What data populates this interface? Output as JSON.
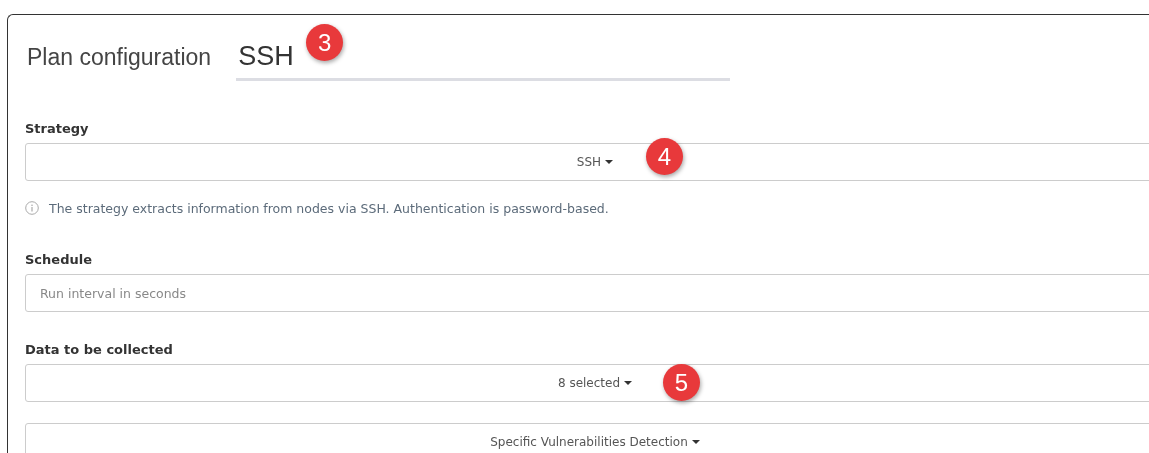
{
  "title": "Plan configuration",
  "plan_name": {
    "value": "SSH",
    "badge": "3"
  },
  "strategy": {
    "label": "Strategy",
    "value": "SSH",
    "badge": "4",
    "info": "The strategy extracts information from nodes via SSH. Authentication is password-based."
  },
  "schedule": {
    "label": "Schedule",
    "placeholder": "Run interval in seconds"
  },
  "data_collected": {
    "label": "Data to be collected",
    "dropdowns": [
      {
        "value": "8 selected",
        "badge": "5"
      },
      {
        "value": "Specific Vulnerabilities Detection"
      }
    ]
  }
}
